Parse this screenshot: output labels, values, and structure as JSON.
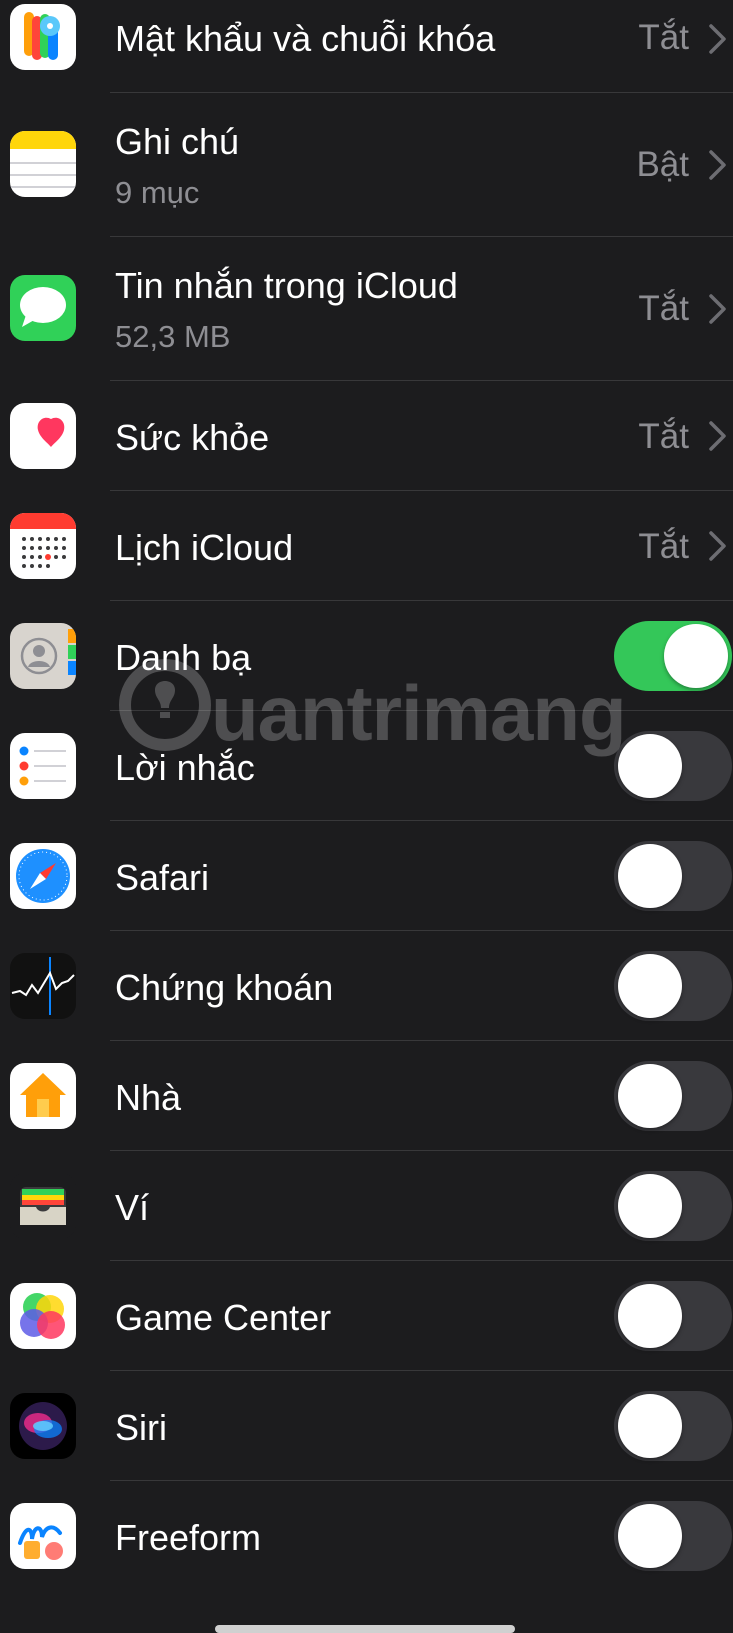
{
  "rows": [
    {
      "label": "Mật khẩu và chuỗi khóa",
      "status": "Tắt"
    },
    {
      "label": "Ghi chú",
      "sublabel": "9 mục",
      "status": "Bật"
    },
    {
      "label": "Tin nhắn trong iCloud",
      "sublabel": "52,3 MB",
      "status": "Tắt"
    },
    {
      "label": "Sức khỏe",
      "status": "Tắt"
    },
    {
      "label": "Lịch iCloud",
      "status": "Tắt"
    },
    {
      "label": "Danh bạ",
      "toggle_on": true
    },
    {
      "label": "Lời nhắc",
      "toggle_on": false
    },
    {
      "label": "Safari",
      "toggle_on": false
    },
    {
      "label": "Chứng khoán",
      "toggle_on": false
    },
    {
      "label": "Nhà",
      "toggle_on": false
    },
    {
      "label": "Ví",
      "toggle_on": false
    },
    {
      "label": "Game Center",
      "toggle_on": false
    },
    {
      "label": "Siri",
      "toggle_on": false
    },
    {
      "label": "Freeform",
      "toggle_on": false
    }
  ],
  "watermark": {
    "text": "uantrimang"
  },
  "colors": {
    "toggle_on": "#34c759",
    "toggle_off": "#39393d",
    "background": "#1c1c1e"
  }
}
